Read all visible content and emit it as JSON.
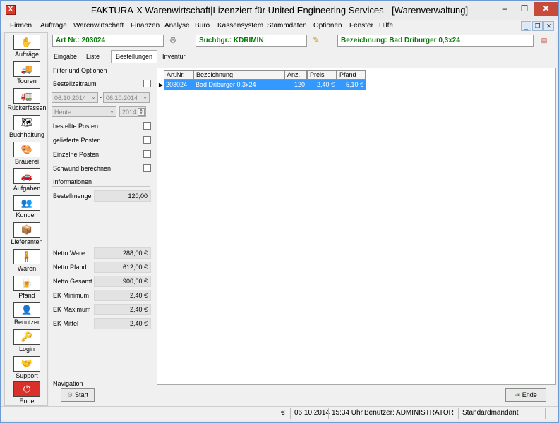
{
  "window": {
    "title": "FAKTURA-X Warenwirtschaft|Lizenziert für United Engineering Services - [Warenverwaltung]",
    "app_icon": "X",
    "min": "–",
    "max": "☐",
    "close": "✕"
  },
  "menu": [
    "Firmen",
    "Aufträge",
    "Warenwirtschaft",
    "Finanzen",
    "Analyse",
    "Büro",
    "Kassensystem",
    "Stammdaten",
    "Optionen",
    "Fenster",
    "Hilfe"
  ],
  "mdi_buttons": [
    "_",
    "❐",
    "✕"
  ],
  "header": {
    "art_nr": "Art Nr.: 203024",
    "suchbegriff": "Suchbgr.: KDRIMIN",
    "bezeichnung": "Bezeichnung: Bad Driburger 0,3x24"
  },
  "sidebar": [
    {
      "label": "Aufträge",
      "icon": "✋"
    },
    {
      "label": "Touren",
      "icon": "🚚"
    },
    {
      "label": "Rückerfassen",
      "icon": "🚛"
    },
    {
      "label": "Buchhaltung",
      "icon": "🗺"
    },
    {
      "label": "Brauerei",
      "icon": "🎨"
    },
    {
      "label": "Aufgaben",
      "icon": "🚗"
    },
    {
      "label": "Kunden",
      "icon": "👥"
    },
    {
      "label": "Lieferanten",
      "icon": "📦"
    },
    {
      "label": "Waren",
      "icon": "🧍"
    },
    {
      "label": "Pfand",
      "icon": "🍺"
    },
    {
      "label": "Benutzer",
      "icon": "👤"
    },
    {
      "label": "Login",
      "icon": "🔑"
    },
    {
      "label": "Support",
      "icon": "🤝"
    },
    {
      "label": "Ende",
      "icon": "⏻"
    }
  ],
  "tabs": [
    "Eingabe",
    "Liste",
    "Bestellungen",
    "Inventur"
  ],
  "filter": {
    "title": "Filter und Optionen",
    "bestellzeitraum": "Bestellzeitraum",
    "date_from": "06.10.2014",
    "date_sep": "-",
    "date_to": "06.10.2014",
    "period": "Heute",
    "year": "2014",
    "options": [
      "bestellte Posten",
      "gelieferte Posten",
      "Einzelne Posten",
      "Schwund berechnen"
    ]
  },
  "info": {
    "title": "Informationen",
    "bestellmenge_label": "Bestellmenge",
    "bestellmenge": "120,00",
    "rows": [
      {
        "label": "Netto Ware",
        "value": "288,00 €"
      },
      {
        "label": "Netto Pfand",
        "value": "612,00 €"
      },
      {
        "label": "Netto Gesamt",
        "value": "900,00 €"
      },
      {
        "label": "EK Minimum",
        "value": "2,40 €"
      },
      {
        "label": "EK Maximum",
        "value": "2,40 €"
      },
      {
        "label": "EK Mittel",
        "value": "2,40 €"
      }
    ]
  },
  "grid": {
    "columns": [
      "Art.Nr.",
      "Bezeichnung",
      "Anz.",
      "Preis",
      "Pfand"
    ],
    "rows": [
      [
        "203024",
        "Bad Driburger 0,3x24",
        "120",
        "2,40 €",
        "5,10 €"
      ]
    ]
  },
  "navigation": {
    "title": "Navigation",
    "start": "Start",
    "ende": "Ende"
  },
  "status": {
    "currency": "€",
    "date": "06.10.2014",
    "time": "15:34 Uhr",
    "user": "Benutzer: ADMINISTRATOR",
    "mandant": "Standardmandant"
  }
}
